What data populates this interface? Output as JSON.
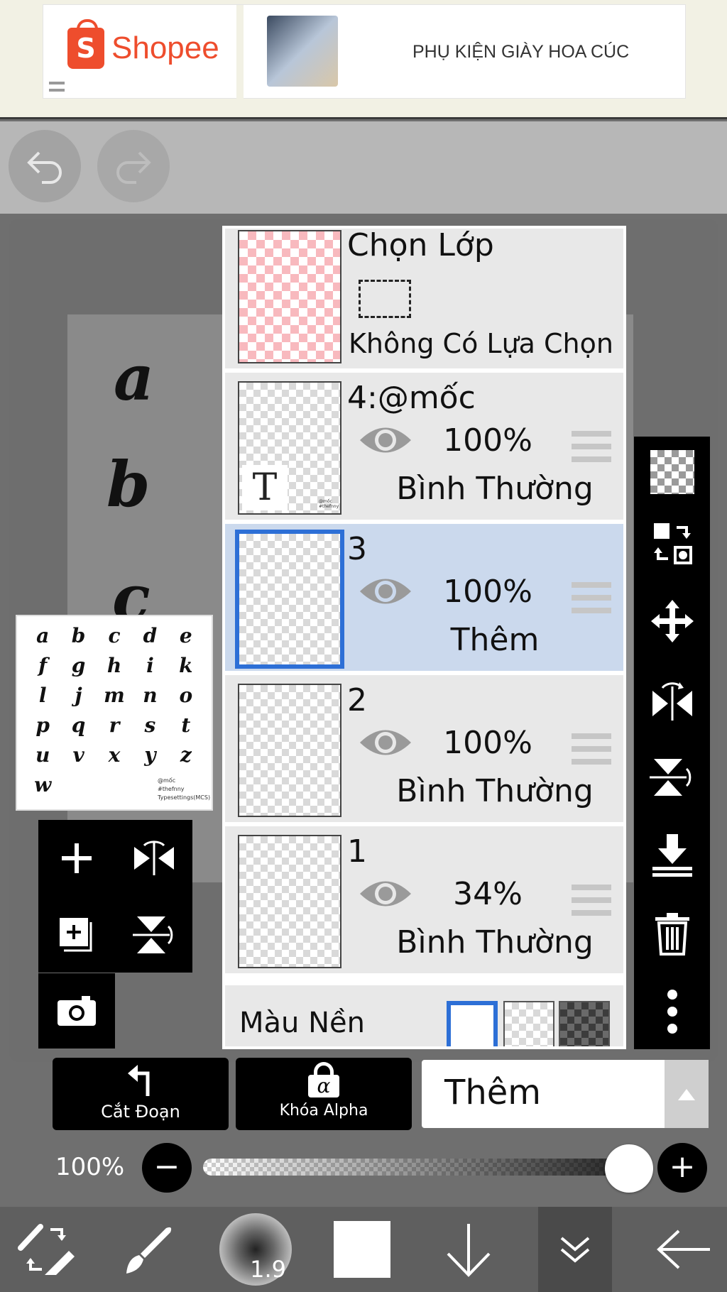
{
  "ad": {
    "brand": "Shopee",
    "brand_letter": "S",
    "text": "PHỤ KIỆN GIÀY HOA CÚC"
  },
  "canvas": {
    "glyphs": [
      "a",
      "b",
      "c"
    ],
    "preview_letters": [
      "a",
      "b",
      "c",
      "d",
      "e",
      "f",
      "g",
      "h",
      "i",
      "k",
      "l",
      "j",
      "m",
      "n",
      "o",
      "p",
      "q",
      "r",
      "s",
      "t",
      "u",
      "v",
      "x",
      "y",
      "z",
      "w"
    ],
    "preview_note": [
      "@mốc",
      "#thefnny",
      "Typesettings(MCS)"
    ]
  },
  "layers_panel": {
    "selection_layer": {
      "title": "Chọn Lớp",
      "status": "Không Có Lựa Chọn"
    },
    "layers": [
      {
        "name": "4:@mốc",
        "opacity": "100%",
        "blend": "Bình Thường",
        "selected": false,
        "thumb_text": "T"
      },
      {
        "name": "3",
        "opacity": "100%",
        "blend": "Thêm",
        "selected": true
      },
      {
        "name": "2",
        "opacity": "100%",
        "blend": "Bình Thường",
        "selected": false
      },
      {
        "name": "1",
        "opacity": "34%",
        "blend": "Bình Thường",
        "selected": false
      }
    ],
    "background": {
      "label": "Màu Nền",
      "options": [
        "white",
        "transparent",
        "dark-checker"
      ],
      "selected": "white"
    }
  },
  "controls": {
    "clipping_label": "Cắt Đoạn",
    "alpha_lock_label": "Khóa Alpha",
    "alpha_symbol": "α",
    "blend_mode": "Thêm",
    "opacity": "100%",
    "opacity_value": 1.0,
    "minus": "−",
    "plus": "+"
  },
  "toolbar": {
    "brush_size": "1.9"
  },
  "colors": {
    "selected_blue": "#2d6fd6",
    "selected_row": "#cbd9ed",
    "shopee": "#ee4d2d"
  }
}
